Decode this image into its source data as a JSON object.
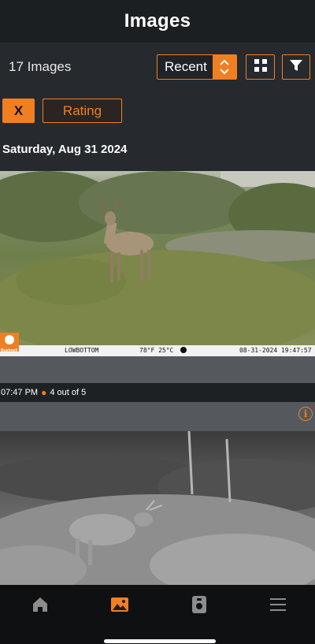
{
  "header": {
    "title": "Images"
  },
  "toolbar": {
    "count_label": "17 Images",
    "sort_value": "Recent",
    "grid_icon": "grid-view-icon",
    "filter_icon": "filter-icon"
  },
  "filters": {
    "clear_label": "X",
    "rating_label": "Rating"
  },
  "section": {
    "date": "Saturday, Aug 31 2024"
  },
  "photo1": {
    "brand": "Bushnell",
    "camera_name": "LOWBOTTOM",
    "temperature": "78°F 25°C",
    "stamp_datetime": "08-31-2024 19:47:57"
  },
  "photo_meta": {
    "time": "07:47 PM",
    "position": "4 out of 5"
  },
  "nav": {
    "items": [
      {
        "icon": "home-icon",
        "active": false
      },
      {
        "icon": "images-icon",
        "active": true
      },
      {
        "icon": "camera-icon",
        "active": false
      },
      {
        "icon": "menu-icon",
        "active": false
      }
    ]
  },
  "colors": {
    "accent": "#f07f22",
    "background": "#262a2e",
    "header": "#1c1f22",
    "nav": "#0f1012"
  }
}
